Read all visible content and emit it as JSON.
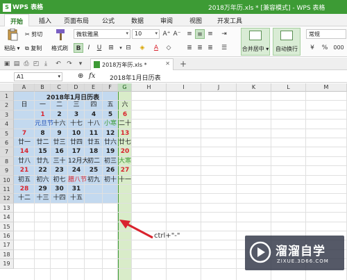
{
  "app": {
    "logo_label": "WPS 表格",
    "doc_title": "2018万年历.xls * [兼容模式] - WPS 表格"
  },
  "menu": {
    "tabs": [
      "开始",
      "插入",
      "页面布局",
      "公式",
      "数据",
      "审阅",
      "视图",
      "开发工具"
    ],
    "active": "开始"
  },
  "ribbon": {
    "paste": "粘贴",
    "cut": "剪切",
    "copy": "复制",
    "format_painter": "格式刷",
    "font_name": "微软雅黑",
    "font_size": "10",
    "font_grow": "A⁺",
    "font_shrink": "A⁻",
    "bold": "B",
    "italic": "I",
    "underline": "U",
    "merge_center": "合并居中",
    "wrap_text": "自动换行",
    "number_format": "常规",
    "percent": "%",
    "thousands": "000"
  },
  "tabstrip": {
    "doc_tab": "2018万年历.xls *",
    "add": "+"
  },
  "formula_bar": {
    "cell_ref": "A1",
    "fx": "fx",
    "value": "2018年1月日历表"
  },
  "grid": {
    "columns": [
      "A",
      "B",
      "C",
      "D",
      "E",
      "F",
      "G",
      "H",
      "I",
      "J",
      "K",
      "L",
      "M"
    ],
    "rows": [
      "1",
      "2",
      "3",
      "4",
      "5",
      "6",
      "7",
      "8",
      "9",
      "10",
      "11",
      "12",
      "13",
      "14",
      "15",
      "16",
      "17",
      "18",
      "19"
    ]
  },
  "calendar": {
    "title": "2018年1月日历表",
    "weekdays": [
      "日",
      "一",
      "二",
      "三",
      "四",
      "五",
      "六"
    ],
    "rows": [
      [
        "",
        "1",
        "2",
        "3",
        "4",
        "5",
        "6"
      ],
      [
        "",
        "元旦节",
        "十六",
        "十七",
        "十八",
        "小寒",
        "二十"
      ],
      [
        "7",
        "8",
        "9",
        "10",
        "11",
        "12",
        "13"
      ],
      [
        "廿一",
        "廿二",
        "廿三",
        "廿四",
        "廿五",
        "廿六",
        "廿七"
      ],
      [
        "14",
        "15",
        "16",
        "17",
        "18",
        "19",
        "20"
      ],
      [
        "廿八",
        "廿九",
        "三十",
        "12月大",
        "初二",
        "初三",
        "大寒"
      ],
      [
        "21",
        "22",
        "23",
        "24",
        "25",
        "26",
        "27"
      ],
      [
        "初五",
        "初六",
        "初七",
        "腊八节",
        "初九",
        "初十",
        "十一"
      ],
      [
        "28",
        "29",
        "30",
        "31",
        "",
        "",
        ""
      ],
      [
        "十二",
        "十三",
        "十四",
        "十五",
        "",
        "",
        ""
      ]
    ],
    "colors": {
      "weekend": "#d9232d",
      "festival": "#1f4eb4",
      "solar_term": "#3d9b35",
      "normal": "#222222",
      "block_fill": "#c3d9ef",
      "highlight_col_fill": "#d9ecc9"
    }
  },
  "annotation": {
    "text": "ctrl+\"-\""
  },
  "watermark": {
    "name": "溜溜自学",
    "url": "ZIXUE.3D66.COM"
  }
}
